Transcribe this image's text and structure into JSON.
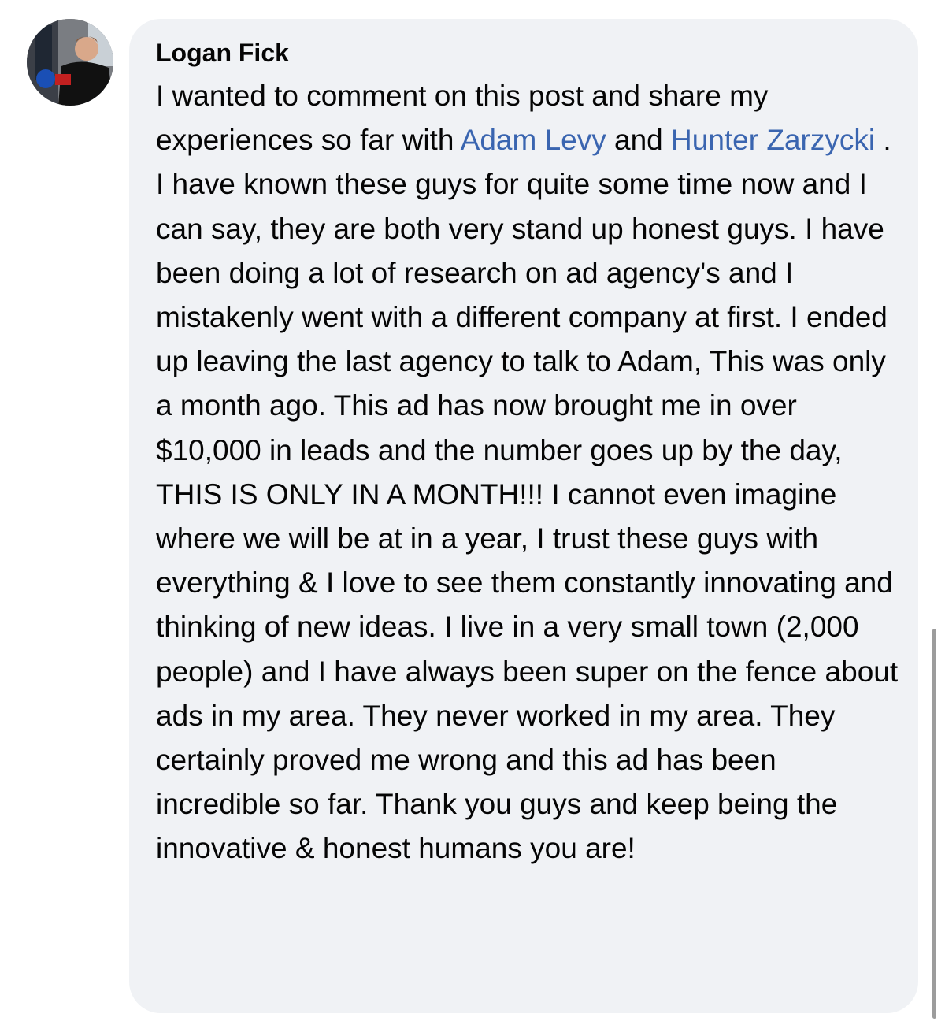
{
  "comment": {
    "author": "Logan Fick",
    "text_part_1": "I wanted to comment on this post and share my experiences so far with ",
    "mention_1": "Adam Levy",
    "text_part_2": " and ",
    "mention_2": "Hunter Zarzycki",
    "text_part_3": " . I have known these guys for quite some time now and I can say, they are both very stand up honest guys. I have been doing a lot of research on ad agency's and I mistakenly went with a different company at first. I ended up leaving the last agency to talk to Adam, This was only a month ago. This ad has now brought me in over $10,000 in leads and the number goes up by the day, THIS IS ONLY IN A MONTH!!! I cannot even imagine where we will be at in a year, I trust these guys with everything & I love to see them constantly innovating and thinking of new ideas. I live in a very small town (2,000 people) and I have always been super on the fence about ads in my area. They never worked in my area. They certainly proved me wrong and this ad has been incredible so far. Thank you guys and keep being the innovative & honest humans you are!"
  },
  "colors": {
    "bubble_background": "#f0f2f5",
    "mention_link": "#3a65b0",
    "text": "#050505"
  },
  "icons": {
    "avatar": "profile-photo"
  }
}
